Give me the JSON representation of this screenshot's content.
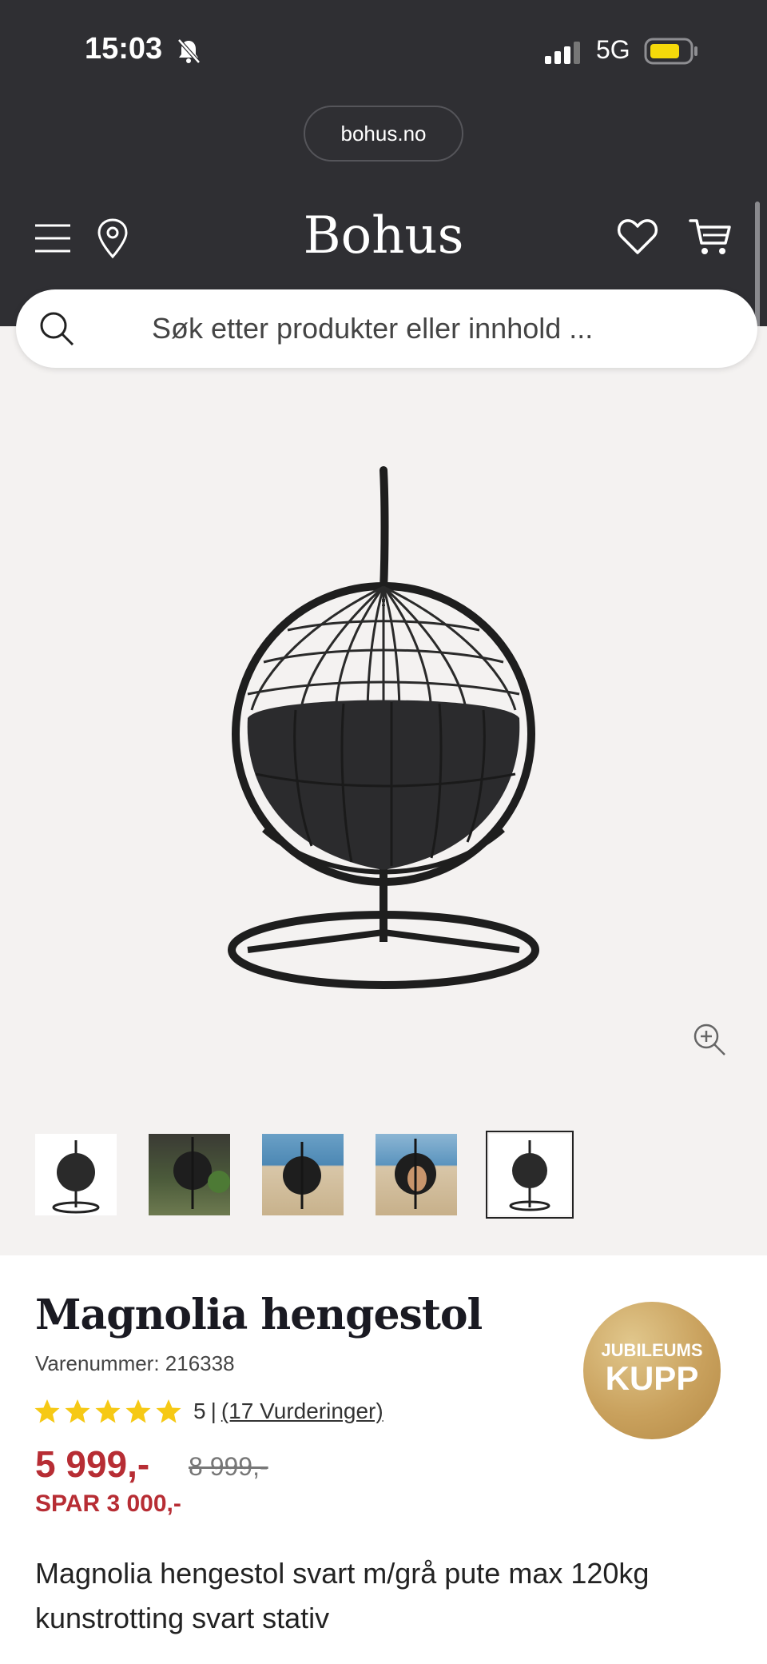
{
  "status_bar": {
    "time": "15:03",
    "network": "5G",
    "icons": [
      "bell-muted-icon",
      "signal-icon",
      "battery-icon"
    ],
    "battery_color": "#f5d90a"
  },
  "browser": {
    "url": "bohus.no"
  },
  "header": {
    "logo": "Bohus",
    "icons": [
      "menu-icon",
      "location-icon",
      "heart-icon",
      "cart-icon"
    ]
  },
  "search": {
    "placeholder": "Søk etter produkter eller innhold ..."
  },
  "gallery": {
    "thumbnail_count": 5,
    "selected_index": 4,
    "zoom_icon": "zoom-in-icon"
  },
  "product": {
    "title": "Magnolia hengestol",
    "sku": "Varenummer: 216338",
    "badge_line1": "JUBILEUMS",
    "badge_line2": "KUPP",
    "rating": {
      "stars": 5,
      "value": "5",
      "separator": "|",
      "reviews": "(17 Vurderinger)"
    },
    "price": "5 999,-",
    "old_price": "8 999,-",
    "save": "SPAR 3 000,-",
    "description": "Magnolia hengestol svart m/grå pute max 120kg kunstrotting svart stativ"
  },
  "colors": {
    "header_bg": "#2f2f33",
    "price_red": "#b72d34",
    "star_yellow": "#f6c915",
    "badge_gold": "#c9a15d",
    "gallery_bg": "#f4f2f1"
  }
}
